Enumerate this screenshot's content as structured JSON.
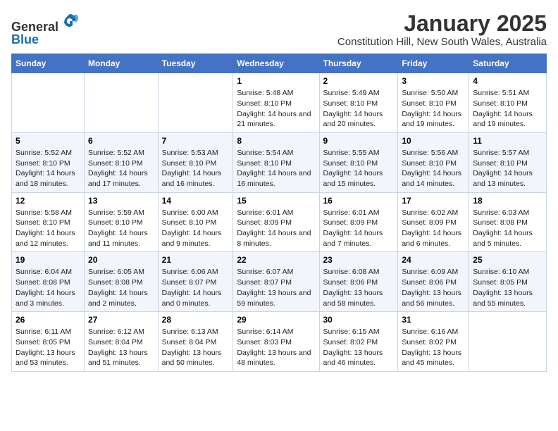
{
  "logo": {
    "general": "General",
    "blue": "Blue"
  },
  "title": "January 2025",
  "subtitle": "Constitution Hill, New South Wales, Australia",
  "weekdays": [
    "Sunday",
    "Monday",
    "Tuesday",
    "Wednesday",
    "Thursday",
    "Friday",
    "Saturday"
  ],
  "weeks": [
    [
      {
        "day": "",
        "info": ""
      },
      {
        "day": "",
        "info": ""
      },
      {
        "day": "",
        "info": ""
      },
      {
        "day": "1",
        "info": "Sunrise: 5:48 AM\nSunset: 8:10 PM\nDaylight: 14 hours and 21 minutes."
      },
      {
        "day": "2",
        "info": "Sunrise: 5:49 AM\nSunset: 8:10 PM\nDaylight: 14 hours and 20 minutes."
      },
      {
        "day": "3",
        "info": "Sunrise: 5:50 AM\nSunset: 8:10 PM\nDaylight: 14 hours and 19 minutes."
      },
      {
        "day": "4",
        "info": "Sunrise: 5:51 AM\nSunset: 8:10 PM\nDaylight: 14 hours and 19 minutes."
      }
    ],
    [
      {
        "day": "5",
        "info": "Sunrise: 5:52 AM\nSunset: 8:10 PM\nDaylight: 14 hours and 18 minutes."
      },
      {
        "day": "6",
        "info": "Sunrise: 5:52 AM\nSunset: 8:10 PM\nDaylight: 14 hours and 17 minutes."
      },
      {
        "day": "7",
        "info": "Sunrise: 5:53 AM\nSunset: 8:10 PM\nDaylight: 14 hours and 16 minutes."
      },
      {
        "day": "8",
        "info": "Sunrise: 5:54 AM\nSunset: 8:10 PM\nDaylight: 14 hours and 16 minutes."
      },
      {
        "day": "9",
        "info": "Sunrise: 5:55 AM\nSunset: 8:10 PM\nDaylight: 14 hours and 15 minutes."
      },
      {
        "day": "10",
        "info": "Sunrise: 5:56 AM\nSunset: 8:10 PM\nDaylight: 14 hours and 14 minutes."
      },
      {
        "day": "11",
        "info": "Sunrise: 5:57 AM\nSunset: 8:10 PM\nDaylight: 14 hours and 13 minutes."
      }
    ],
    [
      {
        "day": "12",
        "info": "Sunrise: 5:58 AM\nSunset: 8:10 PM\nDaylight: 14 hours and 12 minutes."
      },
      {
        "day": "13",
        "info": "Sunrise: 5:59 AM\nSunset: 8:10 PM\nDaylight: 14 hours and 11 minutes."
      },
      {
        "day": "14",
        "info": "Sunrise: 6:00 AM\nSunset: 8:10 PM\nDaylight: 14 hours and 9 minutes."
      },
      {
        "day": "15",
        "info": "Sunrise: 6:01 AM\nSunset: 8:09 PM\nDaylight: 14 hours and 8 minutes."
      },
      {
        "day": "16",
        "info": "Sunrise: 6:01 AM\nSunset: 8:09 PM\nDaylight: 14 hours and 7 minutes."
      },
      {
        "day": "17",
        "info": "Sunrise: 6:02 AM\nSunset: 8:09 PM\nDaylight: 14 hours and 6 minutes."
      },
      {
        "day": "18",
        "info": "Sunrise: 6:03 AM\nSunset: 8:08 PM\nDaylight: 14 hours and 5 minutes."
      }
    ],
    [
      {
        "day": "19",
        "info": "Sunrise: 6:04 AM\nSunset: 8:08 PM\nDaylight: 14 hours and 3 minutes."
      },
      {
        "day": "20",
        "info": "Sunrise: 6:05 AM\nSunset: 8:08 PM\nDaylight: 14 hours and 2 minutes."
      },
      {
        "day": "21",
        "info": "Sunrise: 6:06 AM\nSunset: 8:07 PM\nDaylight: 14 hours and 0 minutes."
      },
      {
        "day": "22",
        "info": "Sunrise: 6:07 AM\nSunset: 8:07 PM\nDaylight: 13 hours and 59 minutes."
      },
      {
        "day": "23",
        "info": "Sunrise: 6:08 AM\nSunset: 8:06 PM\nDaylight: 13 hours and 58 minutes."
      },
      {
        "day": "24",
        "info": "Sunrise: 6:09 AM\nSunset: 8:06 PM\nDaylight: 13 hours and 56 minutes."
      },
      {
        "day": "25",
        "info": "Sunrise: 6:10 AM\nSunset: 8:05 PM\nDaylight: 13 hours and 55 minutes."
      }
    ],
    [
      {
        "day": "26",
        "info": "Sunrise: 6:11 AM\nSunset: 8:05 PM\nDaylight: 13 hours and 53 minutes."
      },
      {
        "day": "27",
        "info": "Sunrise: 6:12 AM\nSunset: 8:04 PM\nDaylight: 13 hours and 51 minutes."
      },
      {
        "day": "28",
        "info": "Sunrise: 6:13 AM\nSunset: 8:04 PM\nDaylight: 13 hours and 50 minutes."
      },
      {
        "day": "29",
        "info": "Sunrise: 6:14 AM\nSunset: 8:03 PM\nDaylight: 13 hours and 48 minutes."
      },
      {
        "day": "30",
        "info": "Sunrise: 6:15 AM\nSunset: 8:02 PM\nDaylight: 13 hours and 46 minutes."
      },
      {
        "day": "31",
        "info": "Sunrise: 6:16 AM\nSunset: 8:02 PM\nDaylight: 13 hours and 45 minutes."
      },
      {
        "day": "",
        "info": ""
      }
    ]
  ]
}
